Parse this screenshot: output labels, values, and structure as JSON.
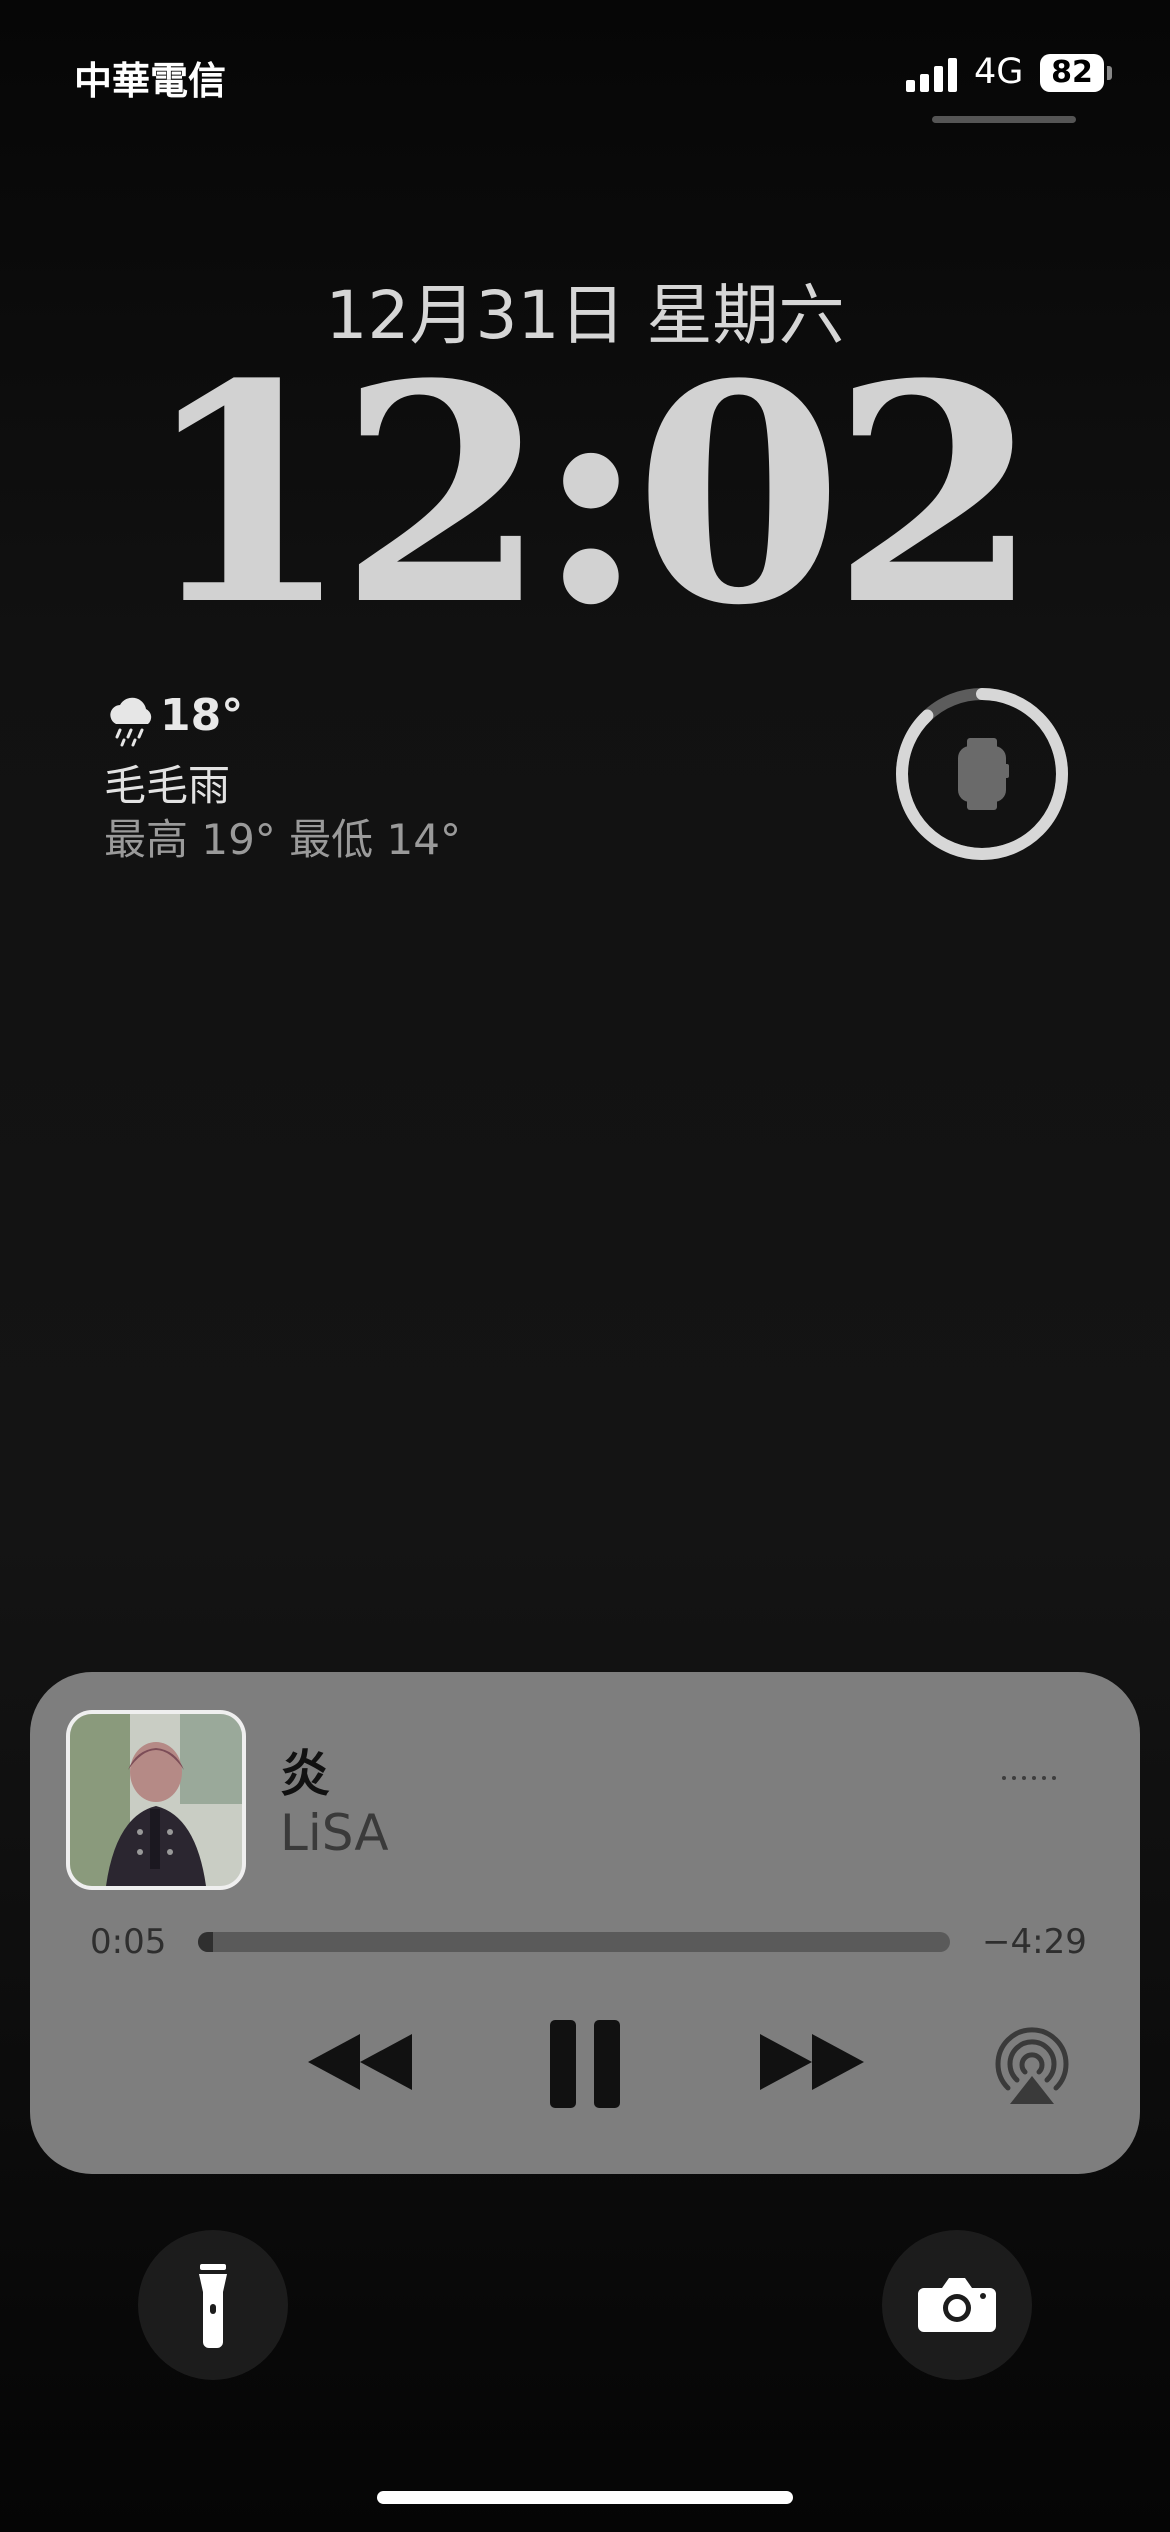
{
  "status_bar": {
    "carrier": "中華電信",
    "network": "4G",
    "battery_level": "82",
    "signal_bars": 4
  },
  "lock_screen": {
    "date": "12月31日 星期六",
    "time": "12:02"
  },
  "weather": {
    "icon": "cloud-drizzle-icon",
    "temperature": "18°",
    "condition": "毛毛雨",
    "high_low": "最高 19° 最低 14°"
  },
  "watch_battery_widget": {
    "icon": "apple-watch-icon",
    "level_fraction": 0.88
  },
  "now_playing": {
    "title": "炎",
    "artist": "LiSA",
    "elapsed": "0:05",
    "remaining": "−4:29",
    "progress_fraction": 0.02,
    "controls": [
      "rewind-icon",
      "pause-icon",
      "fast-forward-icon",
      "airplay-icon"
    ],
    "colors": {
      "panel": "#7e7e7e",
      "track": "#5a5a5a",
      "track_fill": "#2f2f2f"
    }
  },
  "quick_actions": {
    "left": "flashlight-icon",
    "right": "camera-icon"
  }
}
